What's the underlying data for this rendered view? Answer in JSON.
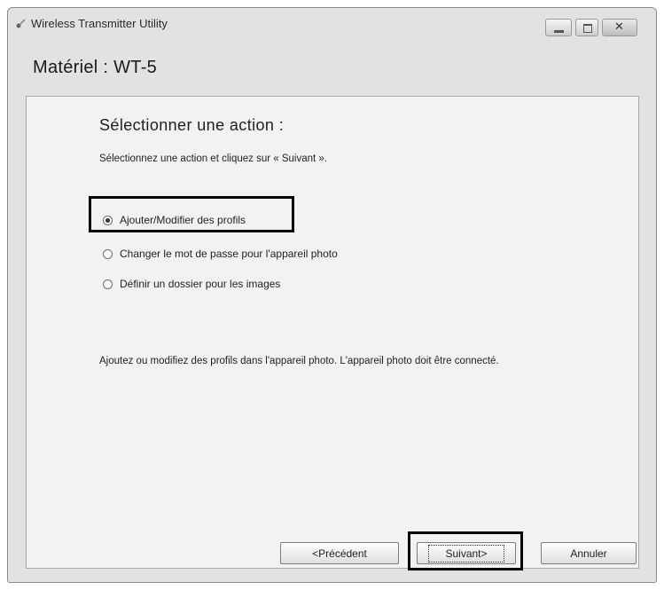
{
  "window": {
    "title": "Wireless Transmitter Utility",
    "device_title": "Matériel : WT-5"
  },
  "main": {
    "heading": "Sélectionner une action :",
    "instruction": "Sélectionnez une action et cliquez sur « Suivant ».",
    "options": [
      {
        "label": "Ajouter/Modifier des profils",
        "checked": true
      },
      {
        "label": "Changer le mot de passe pour l'appareil photo",
        "checked": false
      },
      {
        "label": "Définir un dossier pour les images",
        "checked": false
      }
    ],
    "description": "Ajoutez ou modifiez des profils dans l'appareil photo. L'appareil photo doit être connecté."
  },
  "buttons": {
    "previous": "<Précédent",
    "next": "Suivant>",
    "cancel": "Annuler"
  },
  "colors": {
    "window_bg": "#e2e2e2",
    "panel_bg": "#f2f2f2",
    "highlight": "#000000"
  },
  "icons": {
    "app": "wireless-transmitter-icon",
    "minimize": "minimize-icon",
    "maximize": "maximize-icon",
    "close": "close-icon"
  }
}
